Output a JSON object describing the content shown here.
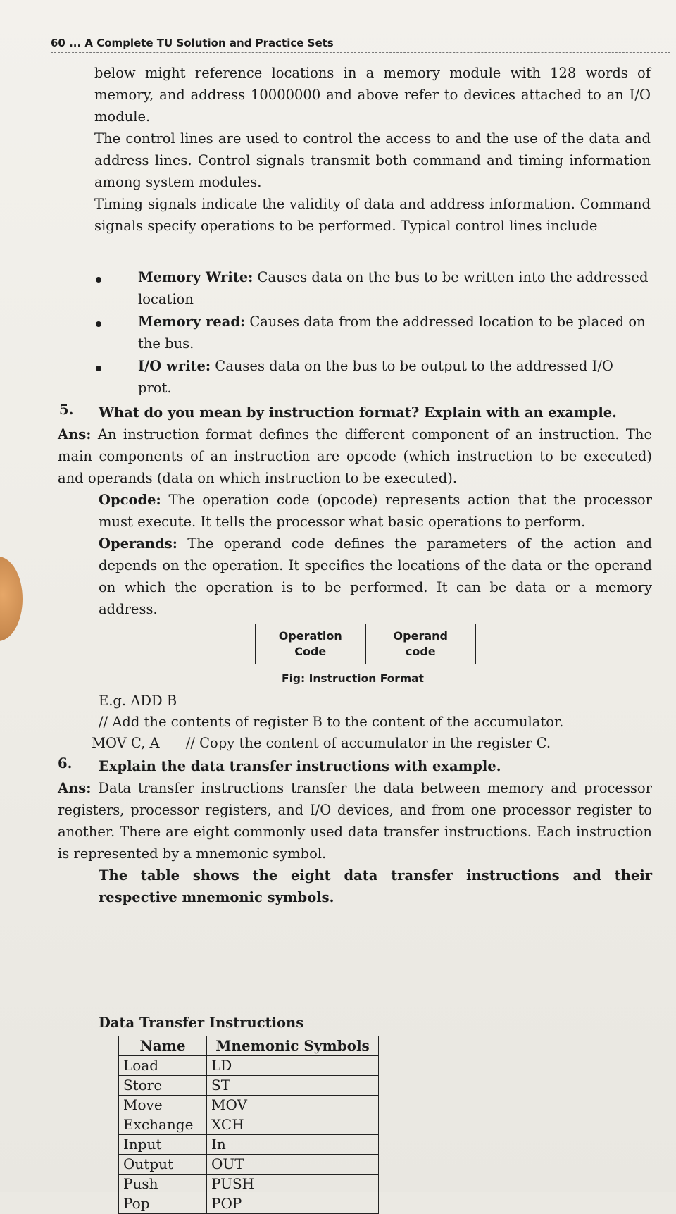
{
  "header": "60 ... A Complete TU Solution and Practice Sets",
  "intro_paragraphs": [
    "below might reference locations in a memory module with 128 words of memory, and address 10000000 and above refer to devices attached to an I/O module.",
    "The control lines are used to control the access to and the use of the data and address lines. Control signals transmit both command and timing information among system modules.",
    "Timing signals indicate the validity of data and address information. Command signals specify operations to be performed. Typical control lines include"
  ],
  "bullets": [
    {
      "term": "Memory Write:",
      "text": " Causes data on the bus to be written into the addressed location"
    },
    {
      "term": "Memory read:",
      "text": " Causes data from the addressed location to be placed on the bus."
    },
    {
      "term": "I/O write:",
      "text": " Causes data on the bus to be output to the addressed I/O prot."
    }
  ],
  "q5": {
    "num": "5.",
    "question": "What do you mean by instruction format? Explain with an example.",
    "ans_label": "Ans:",
    "ans_text": " An instruction format defines the different component of an instruction. The main components of an instruction are opcode (which instruction to be executed) and operands (data on which instruction to be executed).",
    "opcode_term": "Opcode:",
    "opcode_text": " The operation code (opcode) represents action that the processor must execute. It tells the processor what basic operations to perform.",
    "operands_term": "Operands:",
    "operands_text": " The operand code defines the parameters of the action and depends on the operation. It specifies the locations of the data or the operand on which the operation is to be performed. It can be data or a memory address.",
    "figure": {
      "cell1_line1": "Operation",
      "cell1_line2": "Code",
      "cell2_line1": "Operand",
      "cell2_line2": "code",
      "caption": "Fig: Instruction Format"
    },
    "example_lines": [
      "E.g. ADD B",
      "// Add the contents of register B to the content of the accumulator.",
      "MOV C, A      // Copy the content of accumulator in the register C."
    ]
  },
  "q6": {
    "num": "6.",
    "question": "Explain the data transfer instructions with example.",
    "ans_label": "Ans:",
    "ans_text": " Data transfer instructions transfer the data between memory and processor registers, processor registers, and I/O devices, and from one processor register to another. There are eight commonly used data transfer instructions. Each instruction is represented by a mnemonic symbol.",
    "table_intro": "The table shows the eight data transfer instructions and their respective mnemonic symbols.",
    "table_title": "Data Transfer Instructions",
    "table_headers": [
      "Name",
      "Mnemonic Symbols"
    ],
    "table_rows": [
      [
        "Load",
        "LD"
      ],
      [
        "Store",
        "ST"
      ],
      [
        "Move",
        "MOV"
      ],
      [
        "Exchange",
        "XCH"
      ],
      [
        "Input",
        "In"
      ],
      [
        "Output",
        "OUT"
      ],
      [
        "Push",
        "PUSH"
      ],
      [
        "Pop",
        "POP"
      ]
    ]
  }
}
